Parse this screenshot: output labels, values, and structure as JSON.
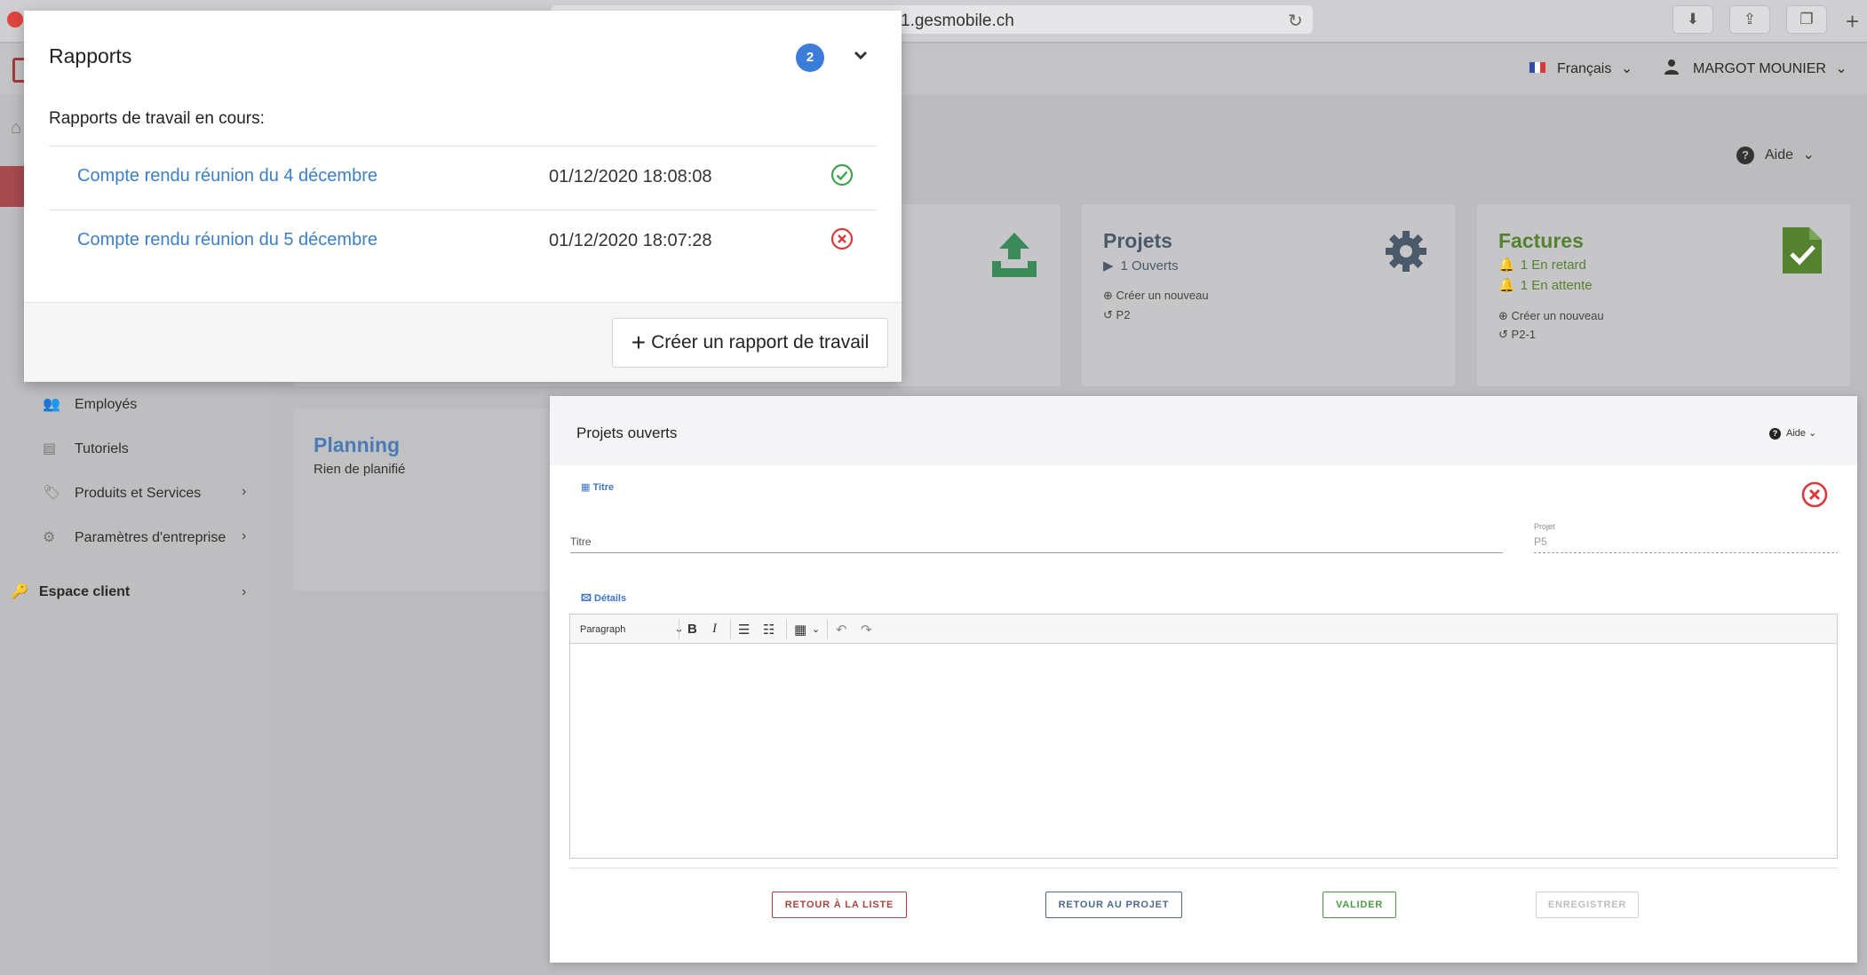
{
  "browser": {
    "url": "1.gesmobile.ch"
  },
  "header": {
    "language": "Français",
    "user": "MARGOT MOUNIER",
    "chevron": "⌄"
  },
  "help": {
    "label": "Aide"
  },
  "sidebar": {
    "items": [
      {
        "label": "Employés",
        "icon": "users-icon",
        "has_submenu": false
      },
      {
        "label": "Tutoriels",
        "icon": "tutorials-icon",
        "has_submenu": false
      },
      {
        "label": "Produits et Services",
        "icon": "tag-icon",
        "has_submenu": true
      },
      {
        "label": "Paramètres d'entreprise",
        "icon": "settings-icon",
        "has_submenu": true
      }
    ],
    "client_space": "Espace client"
  },
  "cards": {
    "projets": {
      "title": "Projets",
      "open": "1 Ouverts",
      "create": "Créer un nouveau",
      "recent": "P2"
    },
    "factures": {
      "title": "Factures",
      "late": "1 En retard",
      "pending": "1 En attente",
      "create": "Créer un nouveau",
      "recent": "P2-1"
    },
    "planning": {
      "title": "Planning",
      "subtitle": "Rien de planifié"
    }
  },
  "rapports": {
    "title": "Rapports",
    "count": "2",
    "subtitle": "Rapports de travail en cours:",
    "rows": [
      {
        "title": "Compte rendu réunion du 4 décembre",
        "date": "01/12/2020 18:08:08",
        "status": "ok"
      },
      {
        "title": "Compte rendu réunion du 5 décembre",
        "date": "01/12/2020 18:07:28",
        "status": "error"
      }
    ],
    "create_label": "Créer un rapport de travail"
  },
  "projets_ouverts": {
    "title": "Projets ouverts",
    "aide": "Aide",
    "section_title": "Titre",
    "field_title_label": "Titre",
    "field_project_label": "Projet",
    "field_project_value": "P5",
    "section_details": "Détails",
    "editor": {
      "paragraph": "Paragraph",
      "bold": "B",
      "italic": "I"
    },
    "buttons": {
      "back_list": "RETOUR À LA LISTE",
      "back_project": "RETOUR AU PROJET",
      "validate": "VALIDER",
      "save": "ENREGISTRER"
    }
  },
  "colors": {
    "link_blue": "#3d7fc6",
    "success_green": "#3fa54a",
    "error_red": "#d93a3a",
    "factures_green": "#55822f",
    "projets_slate": "#4a5a6b"
  }
}
